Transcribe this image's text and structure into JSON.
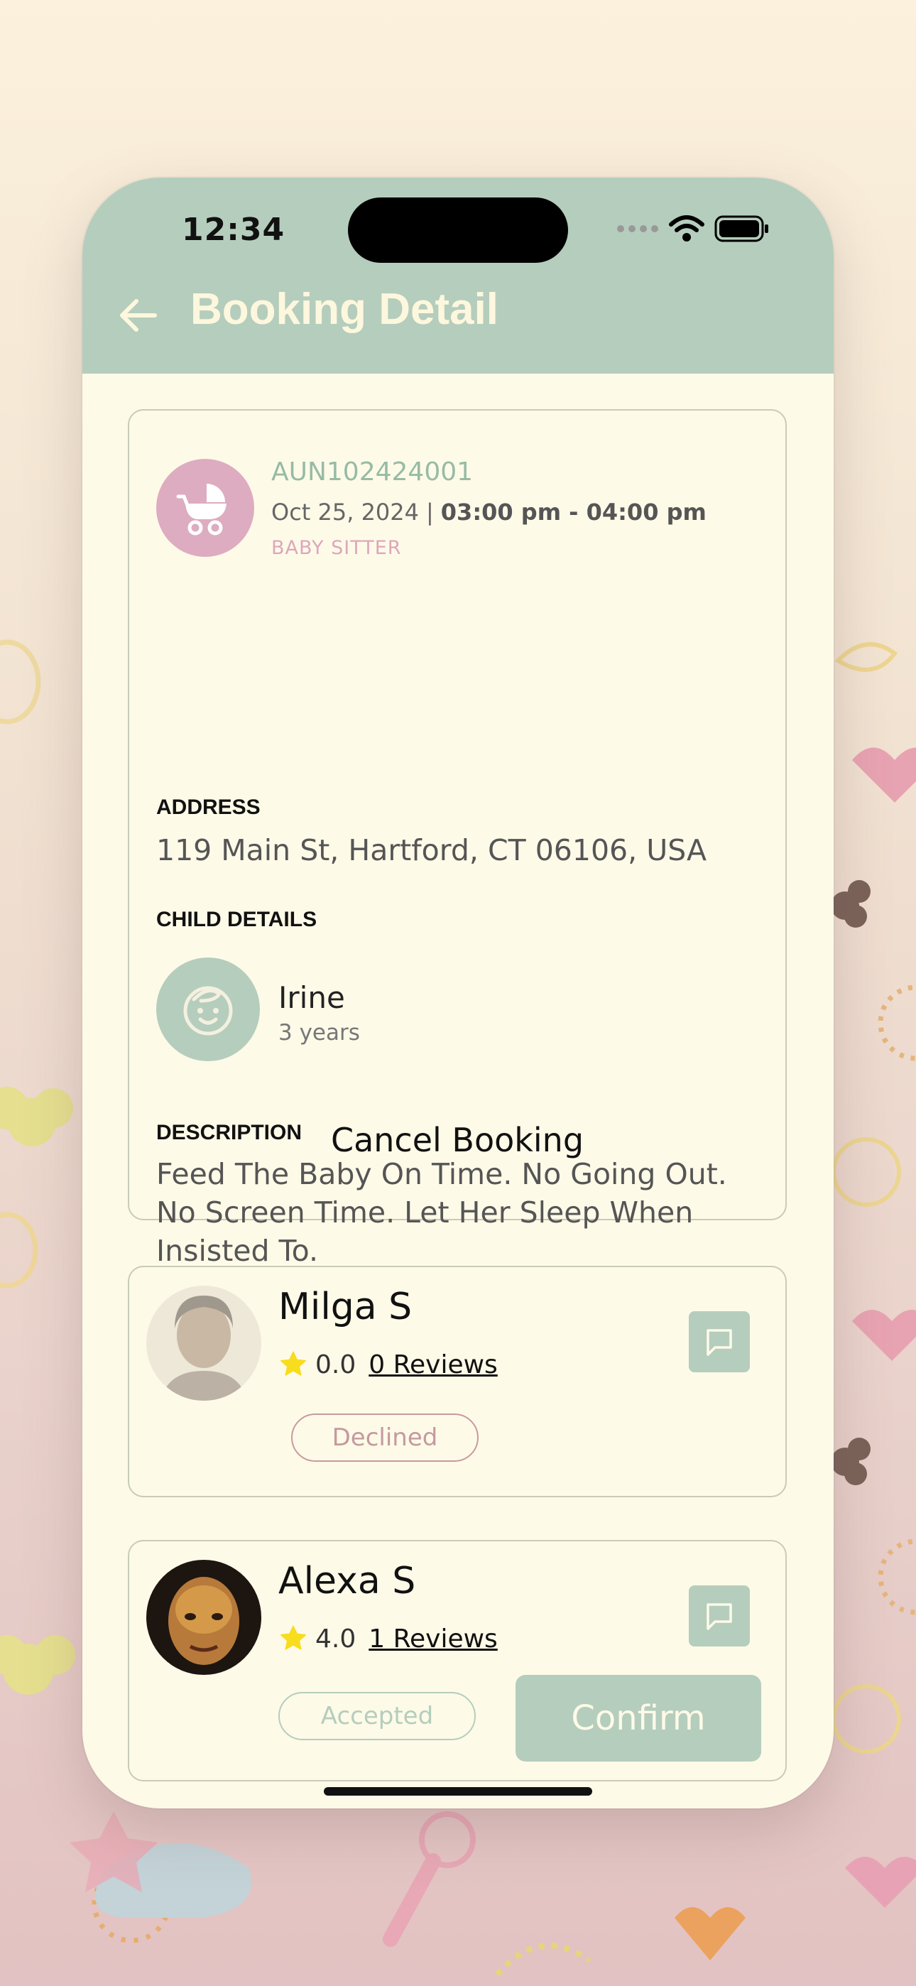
{
  "colors": {
    "header": "#b5cdbd",
    "surface": "#fefae8",
    "accent_pink": "#ddacc0",
    "accent_green": "#97bba4",
    "declined": "#c79aa0"
  },
  "status_bar": {
    "time": "12:34"
  },
  "header": {
    "title": "Booking Detail",
    "back_icon": "arrow-left-icon"
  },
  "booking": {
    "service_icon": "stroller-icon",
    "id": "AUN102424001",
    "date": "Oct 25, 2024",
    "separator": "|",
    "time": "03:00 pm - 04:00 pm",
    "type": "BABY SITTER",
    "address_label": "ADDRESS",
    "address": "119 Main St, Hartford, CT 06106, USA",
    "child_label": "CHILD DETAILS",
    "child": {
      "icon": "smiley-face-icon",
      "name": "Irine",
      "age": "3 years"
    },
    "description_label": "DESCRIPTION",
    "description": "Feed The Baby On Time. No Going Out. No Screen Time. Let Her Sleep When Insisted To.",
    "cancel_label": "Cancel Booking"
  },
  "sitters": [
    {
      "name": "Milga S",
      "rating": "0.0",
      "reviews": "0 Reviews",
      "status": "Declined",
      "chat_icon": "chat-bubble-icon"
    },
    {
      "name": "Alexa S",
      "rating": "4.0",
      "reviews": "1 Reviews",
      "status": "Accepted",
      "confirm_label": "Confirm",
      "chat_icon": "chat-bubble-icon"
    }
  ]
}
